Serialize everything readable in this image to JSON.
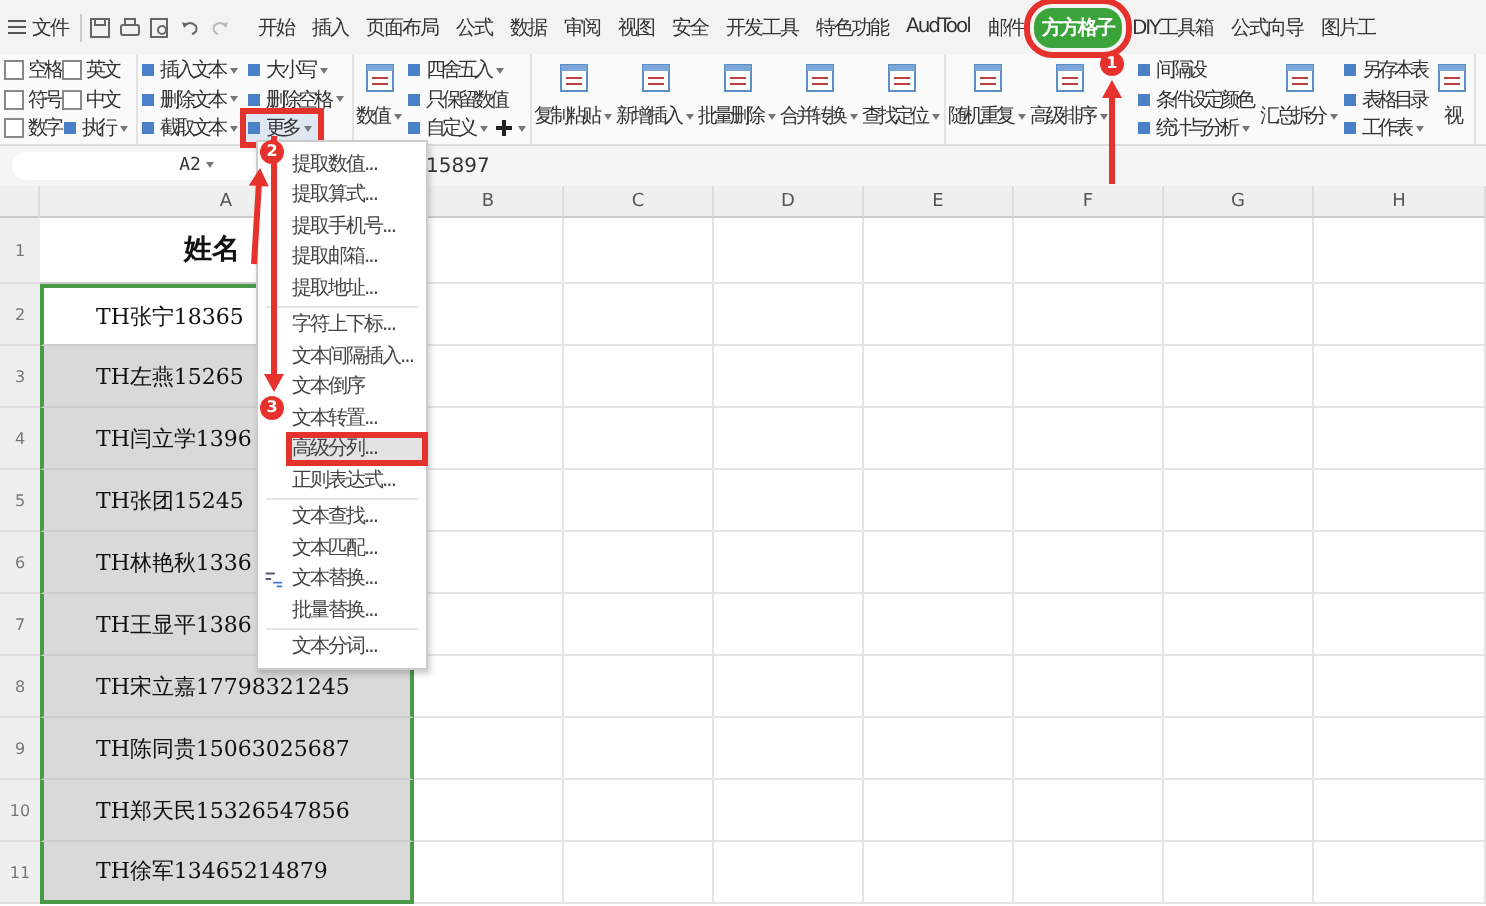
{
  "menu_bar": {
    "file_label": "文件",
    "tabs": [
      {
        "label": "开始",
        "selected": false,
        "boxed": false
      },
      {
        "label": "插入",
        "selected": false,
        "boxed": false
      },
      {
        "label": "页面布局",
        "selected": false,
        "boxed": false
      },
      {
        "label": "公式",
        "selected": false,
        "boxed": false
      },
      {
        "label": "数据",
        "selected": false,
        "boxed": false
      },
      {
        "label": "审阅",
        "selected": false,
        "boxed": false
      },
      {
        "label": "视图",
        "selected": false,
        "boxed": false
      },
      {
        "label": "安全",
        "selected": false,
        "boxed": false
      },
      {
        "label": "开发工具",
        "selected": false,
        "boxed": false
      },
      {
        "label": "特色功能",
        "selected": false,
        "boxed": false
      },
      {
        "label": "AudTool",
        "selected": false,
        "boxed": false
      },
      {
        "label": "邮件",
        "selected": false,
        "boxed": false
      },
      {
        "label": "方方格子",
        "selected": true,
        "boxed": true
      },
      {
        "label": "DIY工具箱",
        "selected": false,
        "boxed": false
      },
      {
        "label": "公式向导",
        "selected": false,
        "boxed": false
      },
      {
        "label": "图片工",
        "selected": false,
        "boxed": false
      }
    ]
  },
  "ribbon": {
    "groups": [
      {
        "columns": [
          [
            {
              "kind": "checkbox",
              "label": "空格",
              "checked": false
            },
            {
              "kind": "checkbox",
              "label": "符号",
              "checked": false
            },
            {
              "kind": "checkbox",
              "label": "数字",
              "checked": false
            }
          ],
          [
            {
              "kind": "checkbox",
              "label": "英文",
              "checked": false
            },
            {
              "kind": "checkbox",
              "label": "中文",
              "checked": false
            },
            {
              "kind": "small",
              "label": "执行",
              "dropdown": true,
              "boxed": false
            }
          ]
        ]
      },
      {
        "columns": [
          [
            {
              "kind": "small",
              "label": "插入文本",
              "dropdown": true,
              "boxed": false
            },
            {
              "kind": "small",
              "label": "删除文本",
              "dropdown": true,
              "boxed": false
            },
            {
              "kind": "small",
              "label": "截取文本",
              "dropdown": true,
              "boxed": false
            }
          ],
          [
            {
              "kind": "small",
              "label": "大小写",
              "dropdown": true,
              "boxed": false
            },
            {
              "kind": "small",
              "label": "删除空格",
              "dropdown": true,
              "boxed": false
            },
            {
              "kind": "small",
              "label": "更多",
              "dropdown": true,
              "boxed": true
            }
          ]
        ]
      },
      {
        "columns": [
          [
            {
              "kind": "large",
              "label": "数值",
              "dropdown": true
            }
          ],
          [
            {
              "kind": "small",
              "label": "四舍五入",
              "dropdown": true,
              "boxed": false
            },
            {
              "kind": "small",
              "label": "只保留数值",
              "dropdown": false,
              "boxed": false
            },
            {
              "kind": "small",
              "label": "自定义",
              "dropdown": true,
              "boxed": false,
              "plus": true
            }
          ]
        ]
      },
      {
        "columns": [
          [
            {
              "kind": "large",
              "label": "复制粘贴",
              "dropdown": true
            }
          ],
          [
            {
              "kind": "large",
              "label": "新增插入",
              "dropdown": true
            }
          ],
          [
            {
              "kind": "large",
              "label": "批量删除",
              "dropdown": true
            }
          ],
          [
            {
              "kind": "large",
              "label": "合并转换",
              "dropdown": true
            }
          ],
          [
            {
              "kind": "large",
              "label": "查找定位",
              "dropdown": true
            }
          ]
        ]
      },
      {
        "columns": [
          [
            {
              "kind": "large",
              "label": "随机重复",
              "dropdown": true
            }
          ],
          [
            {
              "kind": "large",
              "label": "高级排序",
              "dropdown": true
            }
          ],
          [
            {
              "kind": "small",
              "label": "间隔设",
              "dropdown": false,
              "boxed": false
            },
            {
              "kind": "small",
              "label": "条件设定颜色",
              "dropdown": false,
              "boxed": false
            },
            {
              "kind": "small",
              "label": "统计与分析",
              "dropdown": true,
              "boxed": false
            }
          ],
          [
            {
              "kind": "large",
              "label": "汇总拆分",
              "dropdown": true
            }
          ],
          [
            {
              "kind": "small",
              "label": "另存本表",
              "dropdown": false,
              "boxed": false
            },
            {
              "kind": "small",
              "label": "表格目录",
              "dropdown": false,
              "boxed": false
            },
            {
              "kind": "small",
              "label": "工作表",
              "dropdown": true,
              "boxed": false
            }
          ],
          [
            {
              "kind": "large",
              "label": "视"
            }
          ]
        ]
      }
    ]
  },
  "name_box": "A2",
  "formula": "15897",
  "columns": [
    "A",
    "B",
    "C",
    "D",
    "E",
    "F",
    "G",
    "H"
  ],
  "rows": [
    {
      "number": "1",
      "cell": "姓名",
      "kind": "header",
      "selected": false
    },
    {
      "number": "2",
      "cell": "TH张宁18365",
      "kind": "data",
      "selected": false
    },
    {
      "number": "3",
      "cell": "TH左燕15265",
      "kind": "data",
      "selected": true
    },
    {
      "number": "4",
      "cell": "TH闫立学1396",
      "kind": "data",
      "selected": true
    },
    {
      "number": "5",
      "cell": "TH张团15245",
      "kind": "data",
      "selected": true
    },
    {
      "number": "6",
      "cell": "TH林艳秋1336",
      "kind": "data",
      "selected": true
    },
    {
      "number": "7",
      "cell": "TH王显平1386",
      "kind": "data",
      "selected": true
    },
    {
      "number": "8",
      "cell": "TH宋立嘉17798321245",
      "kind": "data",
      "selected": true
    },
    {
      "number": "9",
      "cell": "TH陈同贵15063025687",
      "kind": "data",
      "selected": true
    },
    {
      "number": "10",
      "cell": "TH郑天民15326547856",
      "kind": "data",
      "selected": true
    },
    {
      "number": "11",
      "cell": "TH徐军13465214879",
      "kind": "data",
      "selected": true
    }
  ],
  "dropdown": {
    "items": [
      {
        "label": "提取数值...",
        "highlighted": false
      },
      {
        "label": "提取算式...",
        "highlighted": false
      },
      {
        "label": "提取手机号...",
        "highlighted": false
      },
      {
        "label": "提取邮箱...",
        "highlighted": false
      },
      {
        "label": "提取地址...",
        "highlighted": false
      },
      {
        "label": "字符上下标...",
        "highlighted": false,
        "separator_before": true
      },
      {
        "label": "文本间隔插入...",
        "highlighted": false
      },
      {
        "label": "文本倒序",
        "highlighted": false
      },
      {
        "label": "文本转置...",
        "highlighted": false
      },
      {
        "label": "高级分列...",
        "highlighted": true
      },
      {
        "label": "正则表达式...",
        "highlighted": false
      },
      {
        "label": "文本查找...",
        "highlighted": false,
        "separator_before": true
      },
      {
        "label": "文本匹配...",
        "highlighted": false
      },
      {
        "label": "文本替换...",
        "highlighted": false,
        "icon": true
      },
      {
        "label": "批量替换...",
        "highlighted": false
      },
      {
        "label": "文本分词...",
        "highlighted": false,
        "separator_before": true
      }
    ]
  },
  "annotations": [
    {
      "label": "1"
    },
    {
      "label": "2"
    },
    {
      "label": "3"
    }
  ]
}
